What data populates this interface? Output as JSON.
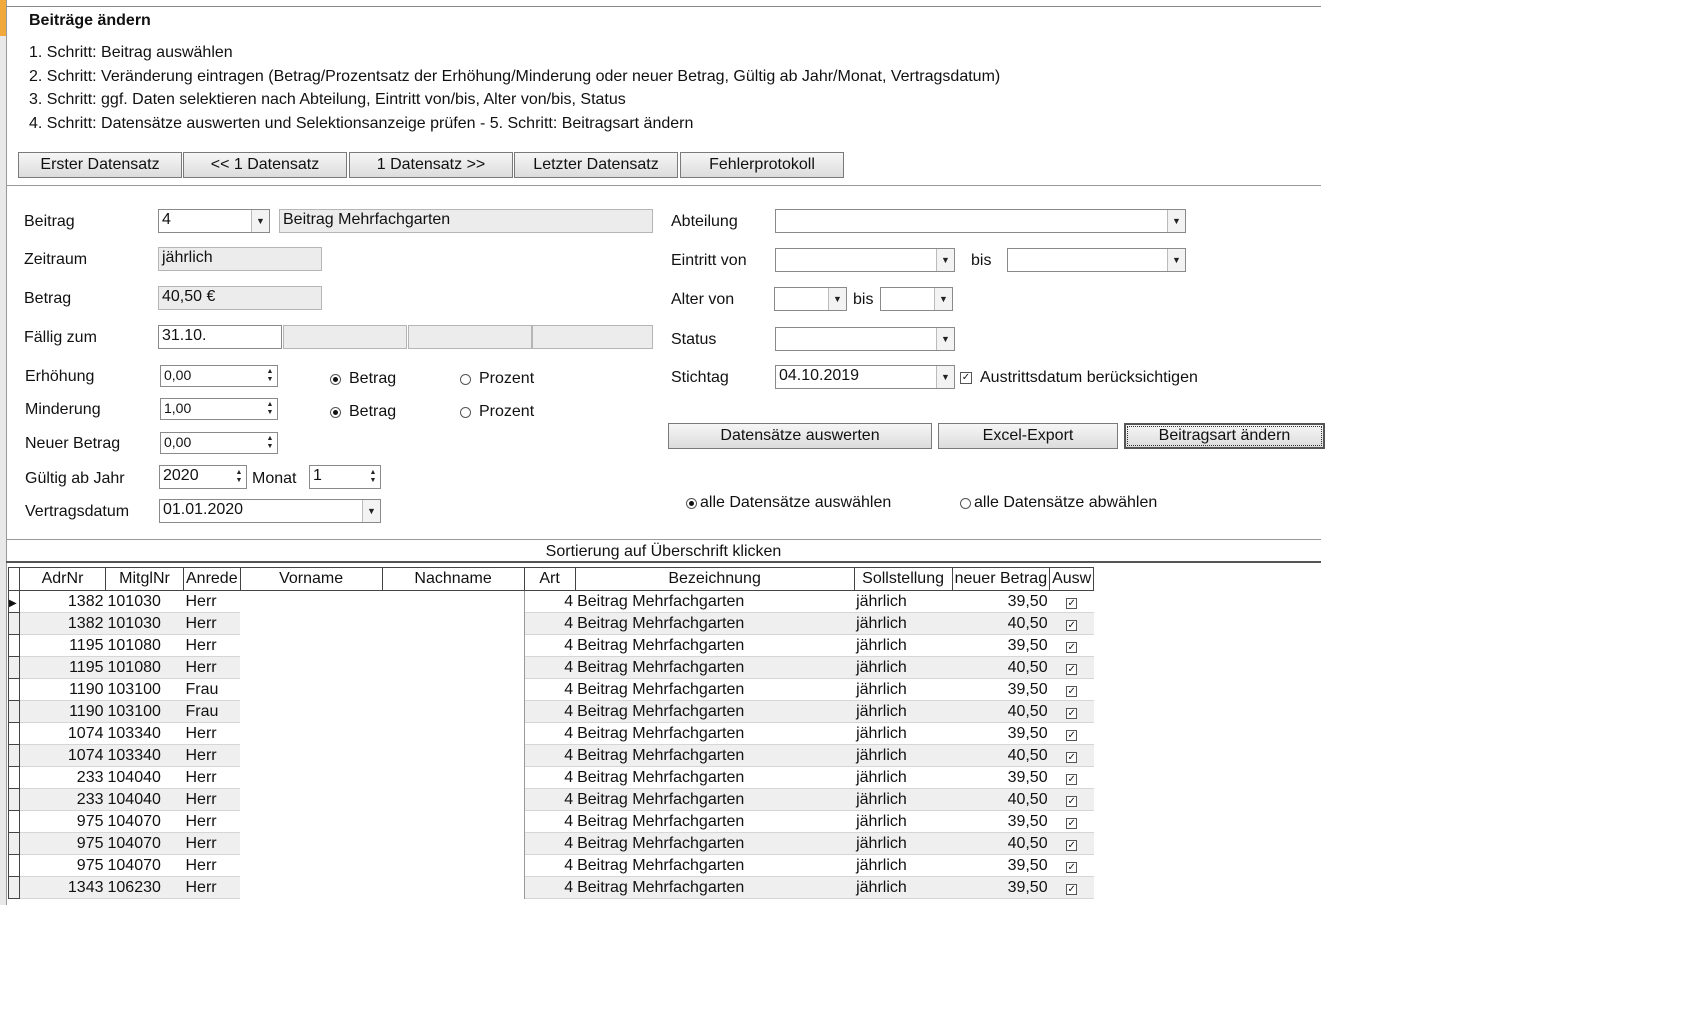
{
  "window": {
    "title": "Beiträge ändern",
    "steps": [
      "1. Schritt: Beitrag auswählen",
      "2. Schritt: Veränderung eintragen (Betrag/Prozentsatz der Erhöhung/Minderung oder neuer Betrag, Gültig ab Jahr/Monat, Vertragsdatum)",
      "3. Schritt: ggf. Daten selektieren nach Abteilung, Eintritt von/bis, Alter von/bis, Status",
      "4. Schritt: Datensätze auswerten und Selektionsanzeige prüfen - 5. Schritt: Beitragsart ändern"
    ]
  },
  "nav": {
    "first": "Erster Datensatz",
    "prev": "<< 1 Datensatz",
    "next": "1 Datensatz >>",
    "last": "Letzter Datensatz",
    "log": "Fehlerprotokoll"
  },
  "form": {
    "beitrag_label": "Beitrag",
    "beitrag_value": "4",
    "beitrag_name": "Beitrag Mehrfachgarten",
    "zeitraum_label": "Zeitraum",
    "zeitraum_value": "jährlich",
    "betrag_label": "Betrag",
    "betrag_value": "40,50 €",
    "faellig_label": "Fällig zum",
    "faellig_value": "31.10.",
    "erhoehung_label": "Erhöhung",
    "erhoehung_value": "0,00",
    "minderung_label": "Minderung",
    "minderung_value": "1,00",
    "neuer_betrag_label": "Neuer Betrag",
    "neuer_betrag_value": "0,00",
    "radio_betrag": "Betrag",
    "radio_prozent": "Prozent",
    "gueltig_label": "Gültig ab Jahr",
    "gueltig_jahr": "2020",
    "monat_label": "Monat",
    "monat_value": "1",
    "vertragsdatum_label": "Vertragsdatum",
    "vertragsdatum_value": "01.01.2020"
  },
  "filter": {
    "abteilung_label": "Abteilung",
    "abteilung_value": "",
    "eintritt_label": "Eintritt von",
    "bis_label": "bis",
    "alter_label": "Alter von",
    "status_label": "Status",
    "status_value": "",
    "stichtag_label": "Stichtag",
    "stichtag_value": "04.10.2019",
    "austritt_label": "Austrittsdatum berücksichtigen",
    "austritt_checked": true
  },
  "actions": {
    "auswerten": "Datensätze auswerten",
    "excel": "Excel-Export",
    "aendern": "Beitragsart ändern",
    "alle_aus": "alle Datensätze auswählen",
    "alle_ab": "alle Datensätze abwählen"
  },
  "grid": {
    "title": "Sortierung auf Überschrift klicken",
    "columns": [
      "AdrNr",
      "MitglNr",
      "Anrede",
      "Vorname",
      "Nachname",
      "Art",
      "Bezeichnung",
      "Sollstellung",
      "neuer Betrag",
      "Ausw"
    ],
    "rows": [
      [
        "1382",
        "101030",
        "Herr",
        "",
        "",
        "4",
        "Beitrag Mehrfachgarten",
        "jährlich",
        "39,50",
        "✓"
      ],
      [
        "1382",
        "101030",
        "Herr",
        "",
        "",
        "4",
        "Beitrag Mehrfachgarten",
        "jährlich",
        "40,50",
        "✓"
      ],
      [
        "1195",
        "101080",
        "Herr",
        "",
        "",
        "4",
        "Beitrag Mehrfachgarten",
        "jährlich",
        "39,50",
        "✓"
      ],
      [
        "1195",
        "101080",
        "Herr",
        "",
        "",
        "4",
        "Beitrag Mehrfachgarten",
        "jährlich",
        "40,50",
        "✓"
      ],
      [
        "1190",
        "103100",
        "Frau",
        "",
        "",
        "4",
        "Beitrag Mehrfachgarten",
        "jährlich",
        "39,50",
        "✓"
      ],
      [
        "1190",
        "103100",
        "Frau",
        "",
        "",
        "4",
        "Beitrag Mehrfachgarten",
        "jährlich",
        "40,50",
        "✓"
      ],
      [
        "1074",
        "103340",
        "Herr",
        "",
        "",
        "4",
        "Beitrag Mehrfachgarten",
        "jährlich",
        "39,50",
        "✓"
      ],
      [
        "1074",
        "103340",
        "Herr",
        "",
        "",
        "4",
        "Beitrag Mehrfachgarten",
        "jährlich",
        "40,50",
        "✓"
      ],
      [
        "233",
        "104040",
        "Herr",
        "",
        "",
        "4",
        "Beitrag Mehrfachgarten",
        "jährlich",
        "39,50",
        "✓"
      ],
      [
        "233",
        "104040",
        "Herr",
        "",
        "",
        "4",
        "Beitrag Mehrfachgarten",
        "jährlich",
        "40,50",
        "✓"
      ],
      [
        "975",
        "104070",
        "Herr",
        "",
        "",
        "4",
        "Beitrag Mehrfachgarten",
        "jährlich",
        "39,50",
        "✓"
      ],
      [
        "975",
        "104070",
        "Herr",
        "",
        "",
        "4",
        "Beitrag Mehrfachgarten",
        "jährlich",
        "40,50",
        "✓"
      ],
      [
        "975",
        "104070",
        "Herr",
        "",
        "",
        "4",
        "Beitrag Mehrfachgarten",
        "jährlich",
        "39,50",
        "✓"
      ],
      [
        "1343",
        "106230",
        "Herr",
        "",
        "",
        "4",
        "Beitrag Mehrfachgarten",
        "jährlich",
        "39,50",
        "✓"
      ]
    ]
  }
}
